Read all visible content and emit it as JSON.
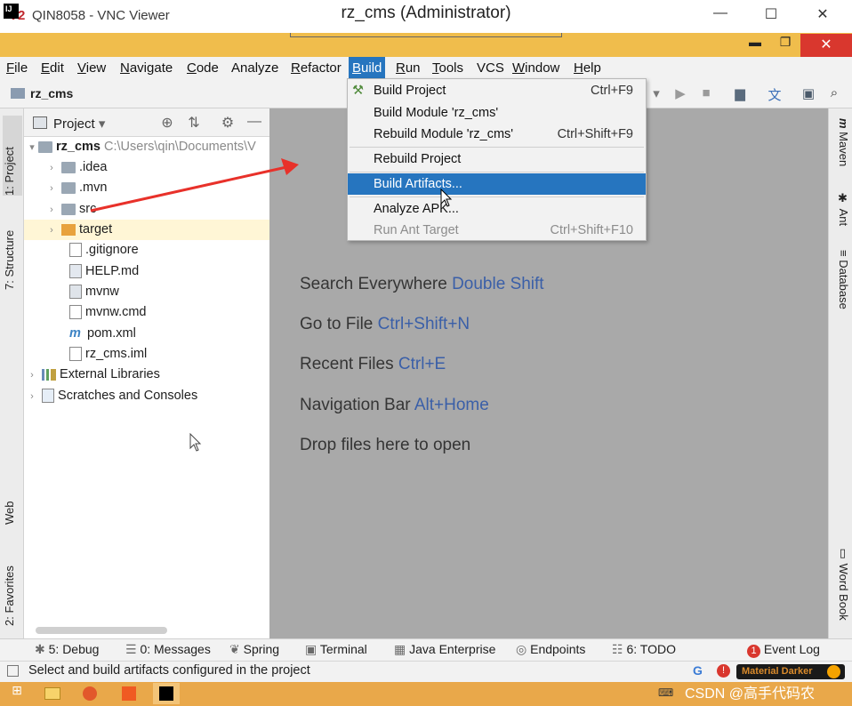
{
  "vnc": {
    "logo": "V2",
    "title": "QIN8058 - VNC Viewer",
    "min": "—",
    "max": "☐",
    "close": "✕"
  },
  "ide": {
    "title": "rz_cms (Administrator)",
    "icon": "IJ",
    "min": "▬",
    "max": "❐",
    "close": "✕"
  },
  "menubar": {
    "items": [
      {
        "label": "File",
        "key": "F",
        "rest": "ile"
      },
      {
        "label": "Edit",
        "key": "E",
        "rest": "dit"
      },
      {
        "label": "View",
        "key": "V",
        "rest": "iew"
      },
      {
        "label": "Navigate",
        "key": "N",
        "rest": "avigate"
      },
      {
        "label": "Code",
        "key": "C",
        "rest": "ode"
      },
      {
        "label": "Analyze",
        "key": "",
        "rest": "Analyze"
      },
      {
        "label": "Refactor",
        "key": "R",
        "rest": "efactor"
      },
      {
        "label": "Build",
        "key": "B",
        "rest": "uild"
      },
      {
        "label": "Run",
        "key": "R",
        "rest": "un"
      },
      {
        "label": "Tools",
        "key": "T",
        "rest": "ools"
      },
      {
        "label": "VCS",
        "key": "",
        "rest": "VCS"
      },
      {
        "label": "Window",
        "key": "W",
        "rest": "indow"
      },
      {
        "label": "Help",
        "key": "H",
        "rest": "elp"
      }
    ]
  },
  "navbar": {
    "crumb": "rz_cms"
  },
  "left_stripe": {
    "project": "1: Project",
    "structure": "7: Structure",
    "web": "Web",
    "favorites": "2: Favorites"
  },
  "right_stripe": {
    "maven": "Maven",
    "ant": "Ant",
    "database": "Database",
    "wordbook": "Word Book"
  },
  "project_pane": {
    "title": "Project",
    "dropdown": "▾",
    "tree": [
      {
        "name": "rz_cms",
        "path": "C:\\Users\\qin\\Documents\\V",
        "level": 0,
        "arrow": "▾",
        "icon": "folder"
      },
      {
        "name": ".idea",
        "level": 1,
        "arrow": "›",
        "icon": "folder"
      },
      {
        "name": ".mvn",
        "level": 1,
        "arrow": "›",
        "icon": "folder"
      },
      {
        "name": "src",
        "level": 1,
        "arrow": "›",
        "icon": "folder"
      },
      {
        "name": "target",
        "level": 1,
        "arrow": "›",
        "icon": "folder-orange"
      },
      {
        "name": ".gitignore",
        "level": 1,
        "arrow": "",
        "icon": "file"
      },
      {
        "name": "HELP.md",
        "level": 1,
        "arrow": "",
        "icon": "file"
      },
      {
        "name": "mvnw",
        "level": 1,
        "arrow": "",
        "icon": "file"
      },
      {
        "name": "mvnw.cmd",
        "level": 1,
        "arrow": "",
        "icon": "file"
      },
      {
        "name": "pom.xml",
        "level": 1,
        "arrow": "",
        "icon": "maven"
      },
      {
        "name": "rz_cms.iml",
        "level": 1,
        "arrow": "",
        "icon": "file"
      },
      {
        "name": "External Libraries",
        "level": 0,
        "arrow": "›",
        "icon": "library"
      },
      {
        "name": "Scratches and Consoles",
        "level": 0,
        "arrow": "›",
        "icon": "scratch"
      }
    ]
  },
  "build_menu": {
    "items": [
      {
        "label": "Build Project",
        "shortcut": "Ctrl+F9"
      },
      {
        "label": "Build Module 'rz_cms'",
        "shortcut": ""
      },
      {
        "label": "Rebuild Module 'rz_cms'",
        "shortcut": "Ctrl+Shift+F9"
      },
      {
        "label": "Rebuild Project",
        "shortcut": ""
      },
      {
        "label": "Build Artifacts...",
        "shortcut": ""
      },
      {
        "label": "Analyze APK...",
        "shortcut": ""
      },
      {
        "label": "Run Ant Target",
        "shortcut": "Ctrl+Shift+F10"
      }
    ]
  },
  "editor": {
    "hints": [
      {
        "text": "Search Everywhere",
        "key": "Double Shift"
      },
      {
        "text": "Go to File",
        "key": "Ctrl+Shift+N"
      },
      {
        "text": "Recent Files",
        "key": "Ctrl+E"
      },
      {
        "text": "Navigation Bar",
        "key": "Alt+Home"
      },
      {
        "text": "Drop files here to open",
        "key": ""
      }
    ]
  },
  "bottom_tools": {
    "debug": "5: Debug",
    "messages": "0: Messages",
    "spring": "Spring",
    "terminal": "Terminal",
    "java_enterprise": "Java Enterprise",
    "endpoints": "Endpoints",
    "todo": "6: TODO",
    "event_log": "Event Log",
    "event_count": "1"
  },
  "status": {
    "text": "Select and build artifacts configured in the project",
    "theme": "Material Darker"
  },
  "taskbar": {
    "watermark": "CSDN @高手代码农"
  },
  "colors": {
    "accent": "#2675bf",
    "ide_title": "#f0bd4c",
    "editor_bg": "#a9a9a9",
    "taskbar": "#e9a84a",
    "close_red": "#d9372e",
    "hint_key": "#3a5fa8",
    "arrow_red": "#e8312a"
  }
}
